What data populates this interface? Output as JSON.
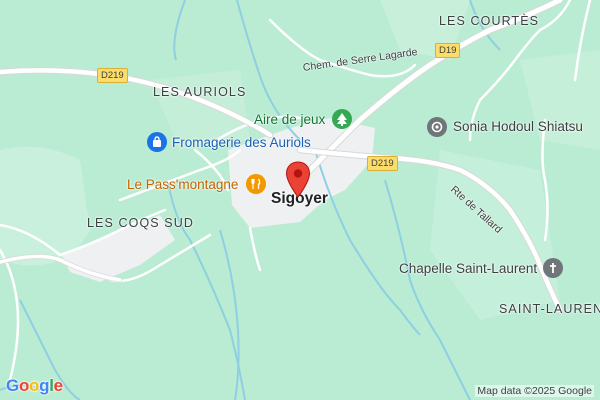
{
  "map": {
    "places": {
      "les_courtes": "LES COURTÈS",
      "les_auriols": "LES AURIOLS",
      "les_coqs_sud": "LES COQS SUD",
      "saint_laurent": "SAINT-LAUREN"
    },
    "town": "Sigoyer",
    "roads": {
      "d219_left": "D219",
      "d219_right": "D219",
      "d19": "D19",
      "chem_serre_lagarde": "Chem. de Serre Lagarde",
      "rte_tallard": "Rte de Tallard"
    },
    "pois": {
      "aire_de_jeux": {
        "label": "Aire de jeux",
        "icon": "tree-icon",
        "color": "#34a853"
      },
      "fromagerie": {
        "label": "Fromagerie des Auriols",
        "icon": "shopping-bag-icon",
        "color": "#1a73e8"
      },
      "pass_montagne": {
        "label": "Le Pass'montagne",
        "icon": "restaurant-icon",
        "color": "#f29900"
      },
      "sonia": {
        "label": "Sonia Hodoul Shiatsu",
        "icon": "spa-icon",
        "color": "#70757a"
      },
      "chapelle": {
        "label": "Chapelle Saint-Laurent",
        "icon": "church-icon",
        "color": "#70757a"
      }
    },
    "pin": {
      "icon": "location-pin-icon",
      "color": "#ea4335"
    },
    "logo": {
      "g1": "G",
      "o1": "o",
      "o2": "o",
      "g2": "g",
      "l": "l",
      "e": "e"
    },
    "attribution": "Map data ©2025 Google"
  }
}
